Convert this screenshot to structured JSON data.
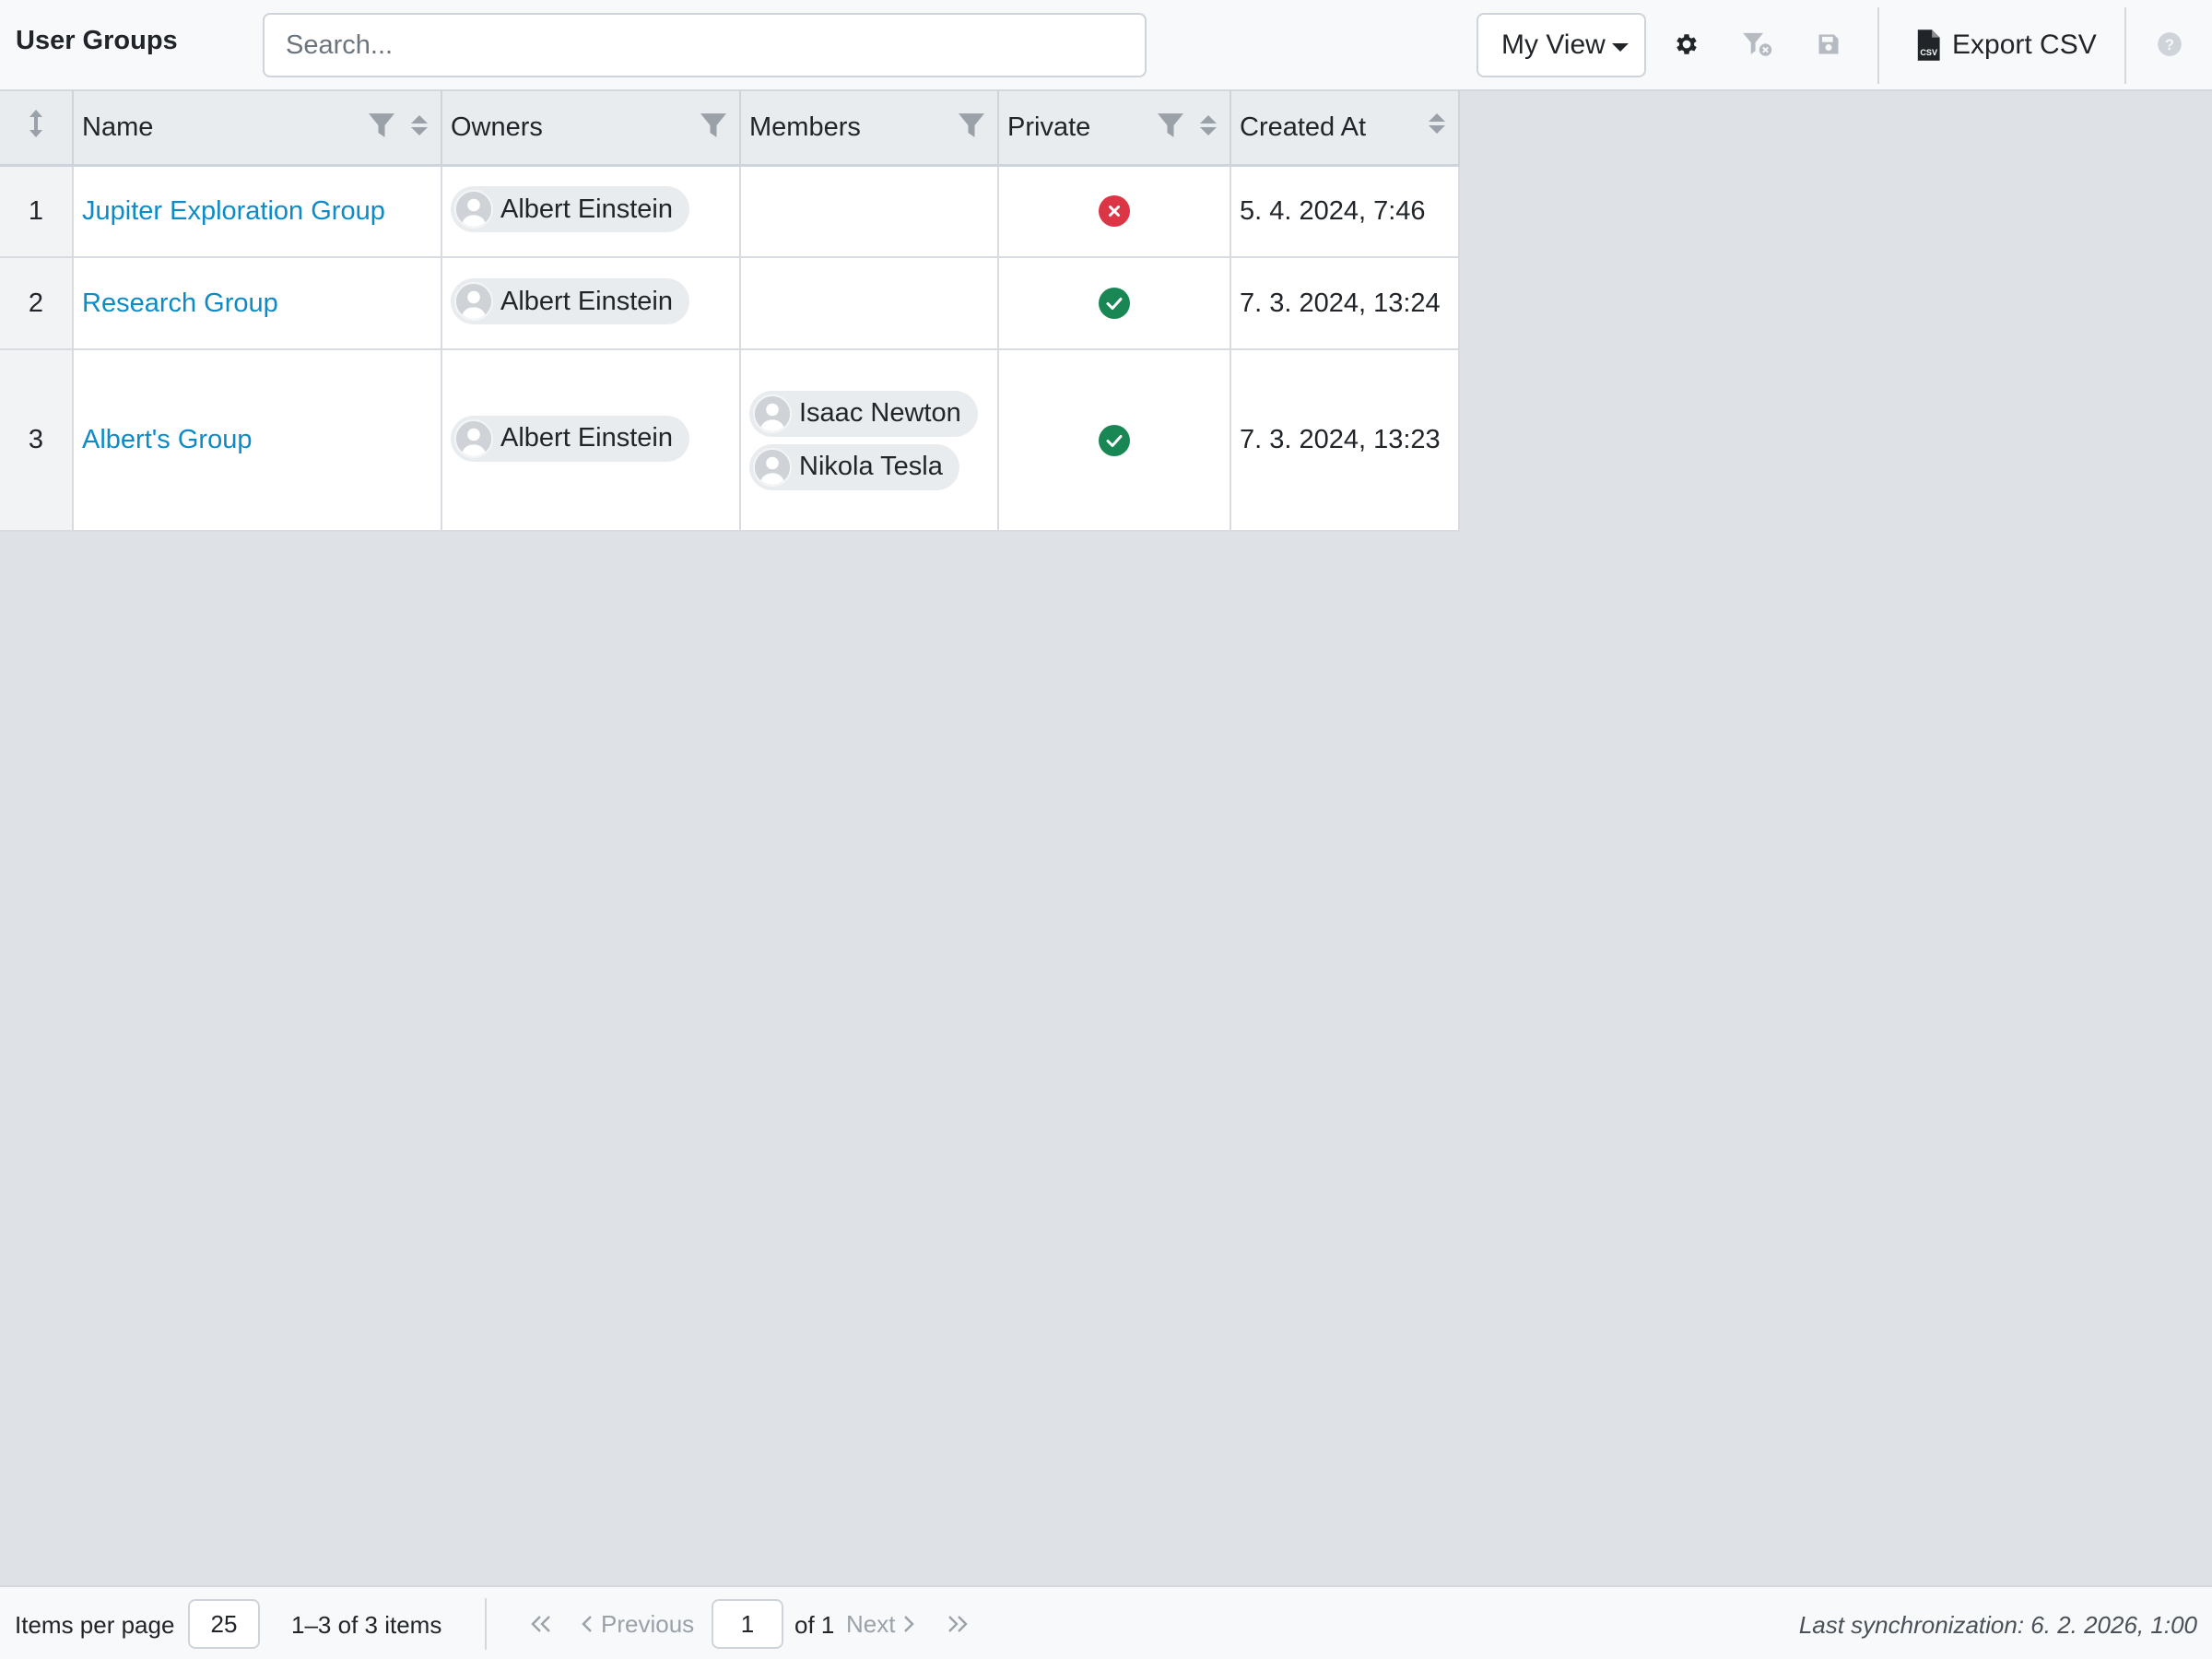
{
  "app": {
    "title": "User Groups"
  },
  "search": {
    "placeholder": "Search..."
  },
  "toolbar": {
    "view_label": "My View",
    "export_label": "Export CSV",
    "icons": [
      "gear-icon",
      "filter-clear-icon",
      "save-icon",
      "file-csv-icon",
      "help-icon"
    ]
  },
  "table": {
    "columns": [
      {
        "label": "",
        "key": "rownum"
      },
      {
        "label": "Name",
        "filter": true,
        "sort": true
      },
      {
        "label": "Owners",
        "filter": true,
        "sort": false
      },
      {
        "label": "Members",
        "filter": true,
        "sort": false
      },
      {
        "label": "Private",
        "filter": true,
        "sort": true
      },
      {
        "label": "Created At",
        "filter": false,
        "sort": true
      }
    ],
    "rows": [
      {
        "num": "1",
        "name": "Jupiter Exploration Group",
        "owners": [
          "Albert Einstein"
        ],
        "members": [],
        "private": false,
        "created": "5. 4. 2024, 7:46"
      },
      {
        "num": "2",
        "name": "Research Group",
        "owners": [
          "Albert Einstein"
        ],
        "members": [],
        "private": true,
        "created": "7. 3. 2024, 13:24"
      },
      {
        "num": "3",
        "name": "Albert's Group",
        "owners": [
          "Albert Einstein"
        ],
        "members": [
          "Isaac Newton",
          "Nikola Tesla"
        ],
        "private": true,
        "created": "7. 3. 2024, 13:23"
      }
    ]
  },
  "footer": {
    "items_per_page_label": "Items per page",
    "items_per_page": "25",
    "range": "1–3 of 3 items",
    "previous_label": "Previous",
    "current_page": "1",
    "of_pages": "of 1",
    "next_label": "Next",
    "last_sync": "Last synchronization: 6. 2. 2026, 1:00"
  },
  "colors": {
    "link": "#0d8bc7",
    "private_true": "#198754",
    "private_false": "#dc3545",
    "background": "#dee1e6"
  }
}
